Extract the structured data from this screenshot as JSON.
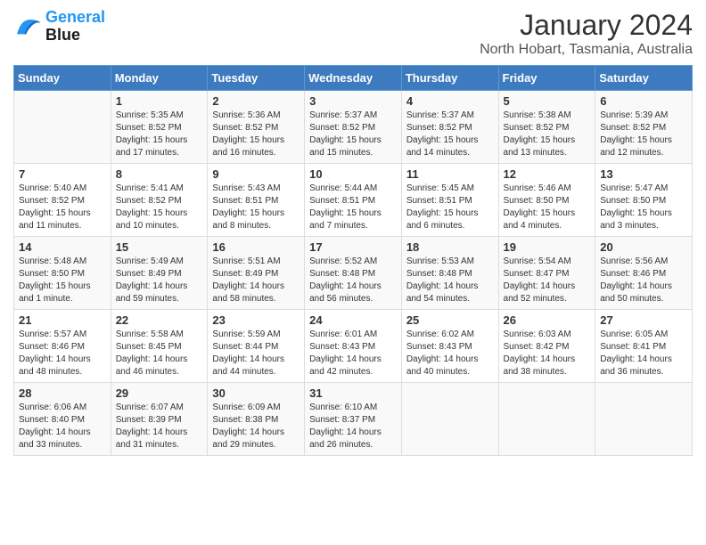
{
  "logo": {
    "line1": "General",
    "line2": "Blue"
  },
  "title": "January 2024",
  "subtitle": "North Hobart, Tasmania, Australia",
  "days_of_week": [
    "Sunday",
    "Monday",
    "Tuesday",
    "Wednesday",
    "Thursday",
    "Friday",
    "Saturday"
  ],
  "weeks": [
    [
      {
        "day": "",
        "info": ""
      },
      {
        "day": "1",
        "info": "Sunrise: 5:35 AM\nSunset: 8:52 PM\nDaylight: 15 hours\nand 17 minutes."
      },
      {
        "day": "2",
        "info": "Sunrise: 5:36 AM\nSunset: 8:52 PM\nDaylight: 15 hours\nand 16 minutes."
      },
      {
        "day": "3",
        "info": "Sunrise: 5:37 AM\nSunset: 8:52 PM\nDaylight: 15 hours\nand 15 minutes."
      },
      {
        "day": "4",
        "info": "Sunrise: 5:37 AM\nSunset: 8:52 PM\nDaylight: 15 hours\nand 14 minutes."
      },
      {
        "day": "5",
        "info": "Sunrise: 5:38 AM\nSunset: 8:52 PM\nDaylight: 15 hours\nand 13 minutes."
      },
      {
        "day": "6",
        "info": "Sunrise: 5:39 AM\nSunset: 8:52 PM\nDaylight: 15 hours\nand 12 minutes."
      }
    ],
    [
      {
        "day": "7",
        "info": "Sunrise: 5:40 AM\nSunset: 8:52 PM\nDaylight: 15 hours\nand 11 minutes."
      },
      {
        "day": "8",
        "info": "Sunrise: 5:41 AM\nSunset: 8:52 PM\nDaylight: 15 hours\nand 10 minutes."
      },
      {
        "day": "9",
        "info": "Sunrise: 5:43 AM\nSunset: 8:51 PM\nDaylight: 15 hours\nand 8 minutes."
      },
      {
        "day": "10",
        "info": "Sunrise: 5:44 AM\nSunset: 8:51 PM\nDaylight: 15 hours\nand 7 minutes."
      },
      {
        "day": "11",
        "info": "Sunrise: 5:45 AM\nSunset: 8:51 PM\nDaylight: 15 hours\nand 6 minutes."
      },
      {
        "day": "12",
        "info": "Sunrise: 5:46 AM\nSunset: 8:50 PM\nDaylight: 15 hours\nand 4 minutes."
      },
      {
        "day": "13",
        "info": "Sunrise: 5:47 AM\nSunset: 8:50 PM\nDaylight: 15 hours\nand 3 minutes."
      }
    ],
    [
      {
        "day": "14",
        "info": "Sunrise: 5:48 AM\nSunset: 8:50 PM\nDaylight: 15 hours\nand 1 minute."
      },
      {
        "day": "15",
        "info": "Sunrise: 5:49 AM\nSunset: 8:49 PM\nDaylight: 14 hours\nand 59 minutes."
      },
      {
        "day": "16",
        "info": "Sunrise: 5:51 AM\nSunset: 8:49 PM\nDaylight: 14 hours\nand 58 minutes."
      },
      {
        "day": "17",
        "info": "Sunrise: 5:52 AM\nSunset: 8:48 PM\nDaylight: 14 hours\nand 56 minutes."
      },
      {
        "day": "18",
        "info": "Sunrise: 5:53 AM\nSunset: 8:48 PM\nDaylight: 14 hours\nand 54 minutes."
      },
      {
        "day": "19",
        "info": "Sunrise: 5:54 AM\nSunset: 8:47 PM\nDaylight: 14 hours\nand 52 minutes."
      },
      {
        "day": "20",
        "info": "Sunrise: 5:56 AM\nSunset: 8:46 PM\nDaylight: 14 hours\nand 50 minutes."
      }
    ],
    [
      {
        "day": "21",
        "info": "Sunrise: 5:57 AM\nSunset: 8:46 PM\nDaylight: 14 hours\nand 48 minutes."
      },
      {
        "day": "22",
        "info": "Sunrise: 5:58 AM\nSunset: 8:45 PM\nDaylight: 14 hours\nand 46 minutes."
      },
      {
        "day": "23",
        "info": "Sunrise: 5:59 AM\nSunset: 8:44 PM\nDaylight: 14 hours\nand 44 minutes."
      },
      {
        "day": "24",
        "info": "Sunrise: 6:01 AM\nSunset: 8:43 PM\nDaylight: 14 hours\nand 42 minutes."
      },
      {
        "day": "25",
        "info": "Sunrise: 6:02 AM\nSunset: 8:43 PM\nDaylight: 14 hours\nand 40 minutes."
      },
      {
        "day": "26",
        "info": "Sunrise: 6:03 AM\nSunset: 8:42 PM\nDaylight: 14 hours\nand 38 minutes."
      },
      {
        "day": "27",
        "info": "Sunrise: 6:05 AM\nSunset: 8:41 PM\nDaylight: 14 hours\nand 36 minutes."
      }
    ],
    [
      {
        "day": "28",
        "info": "Sunrise: 6:06 AM\nSunset: 8:40 PM\nDaylight: 14 hours\nand 33 minutes."
      },
      {
        "day": "29",
        "info": "Sunrise: 6:07 AM\nSunset: 8:39 PM\nDaylight: 14 hours\nand 31 minutes."
      },
      {
        "day": "30",
        "info": "Sunrise: 6:09 AM\nSunset: 8:38 PM\nDaylight: 14 hours\nand 29 minutes."
      },
      {
        "day": "31",
        "info": "Sunrise: 6:10 AM\nSunset: 8:37 PM\nDaylight: 14 hours\nand 26 minutes."
      },
      {
        "day": "",
        "info": ""
      },
      {
        "day": "",
        "info": ""
      },
      {
        "day": "",
        "info": ""
      }
    ]
  ]
}
